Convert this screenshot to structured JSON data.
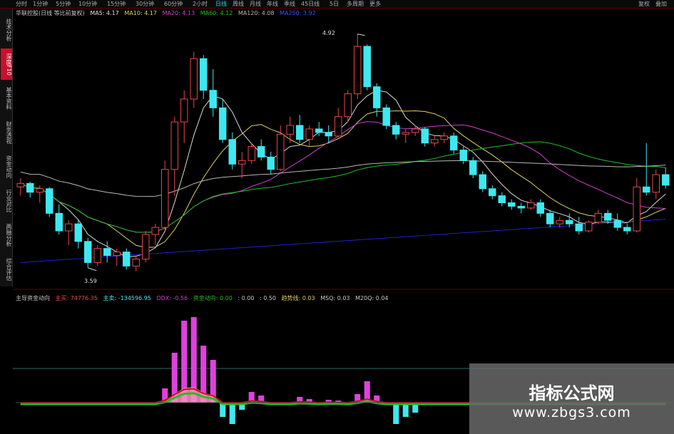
{
  "top_bar": {
    "tabs": [
      "分时",
      "1分钟",
      "5分钟",
      "10分钟",
      "15分钟",
      "30分钟",
      "60分钟",
      "2小时",
      "日线",
      "周线",
      "月线",
      "年线",
      "季线",
      "45日线",
      "5日",
      "多周期",
      "更多"
    ],
    "active": "日线",
    "right_items": [
      "复权",
      "叠加"
    ]
  },
  "left_tabs": [
    "技术分析",
    "深度F10",
    "基本资料",
    "财务透视",
    "资金动向",
    "行业对比",
    "两融分析",
    "综合评估"
  ],
  "main_info": {
    "stock": "华联控股(日线 等比前复权)",
    "ma5": "MA5: 4.17",
    "ma10": "MA10: 4.17",
    "ma20": "MA20: 4.13",
    "ma60": "MA60: 4.12",
    "ma120": "MA120: 4.08",
    "ma250": "MA250: 3.92"
  },
  "price_marks": {
    "high": "4.92",
    "low": "3.59"
  },
  "sub_info": {
    "name": "主导资金动向",
    "zhumai": "主买: 74776.35",
    "zhumai_arrow": "↑",
    "zhumai2": "主卖: -134596.95",
    "zhumai2_arrow": "↓",
    "ddx": "DDX: -0.56",
    "zjdx": "资金动向: 0.00",
    "v1": ": 0.00",
    "v2": ": 0.50",
    "qs": "趋势线: 0.03",
    "msq": "MSQ: 0.03",
    "m20q": "M20Q: 0.04"
  },
  "watermark": {
    "line1": "指标公式网",
    "line2": "www.zbgs3.com"
  },
  "colors": {
    "up": "#e8474a",
    "down": "#3ee8f0",
    "ma5": "#d8d8d8",
    "ma10": "#e0d060",
    "ma20": "#d040d0",
    "ma60": "#20c020",
    "ma120": "#b8b8b0",
    "ma250": "#2020c8"
  },
  "chart_data": {
    "type": "candlestick",
    "candles_note": "daily OHLC estimated from price axis",
    "candles": [
      [
        4.05,
        4.1,
        4.0,
        4.07
      ],
      [
        4.07,
        4.08,
        3.99,
        4.02
      ],
      [
        4.02,
        4.06,
        3.96,
        4.04
      ],
      [
        4.04,
        4.05,
        3.88,
        3.9
      ],
      [
        3.9,
        3.95,
        3.78,
        3.8
      ],
      [
        3.8,
        3.86,
        3.72,
        3.84
      ],
      [
        3.84,
        3.86,
        3.7,
        3.74
      ],
      [
        3.74,
        3.76,
        3.59,
        3.62
      ],
      [
        3.62,
        3.72,
        3.6,
        3.7
      ],
      [
        3.7,
        3.74,
        3.62,
        3.66
      ],
      [
        3.66,
        3.7,
        3.6,
        3.68
      ],
      [
        3.68,
        3.7,
        3.58,
        3.6
      ],
      [
        3.6,
        3.66,
        3.57,
        3.64
      ],
      [
        3.64,
        3.8,
        3.62,
        3.78
      ],
      [
        3.78,
        3.84,
        3.72,
        3.82
      ],
      [
        3.82,
        4.2,
        3.8,
        4.15
      ],
      [
        4.15,
        4.45,
        4.0,
        4.42
      ],
      [
        4.42,
        4.6,
        4.3,
        4.55
      ],
      [
        4.55,
        4.82,
        4.5,
        4.78
      ],
      [
        4.78,
        4.8,
        4.55,
        4.6
      ],
      [
        4.6,
        4.72,
        4.45,
        4.5
      ],
      [
        4.5,
        4.55,
        4.3,
        4.32
      ],
      [
        4.32,
        4.36,
        4.15,
        4.18
      ],
      [
        4.18,
        4.25,
        4.1,
        4.2
      ],
      [
        4.2,
        4.3,
        4.18,
        4.28
      ],
      [
        4.28,
        4.32,
        4.2,
        4.22
      ],
      [
        4.22,
        4.25,
        4.12,
        4.15
      ],
      [
        4.15,
        4.4,
        4.14,
        4.35
      ],
      [
        4.35,
        4.45,
        4.3,
        4.4
      ],
      [
        4.4,
        4.46,
        4.3,
        4.32
      ],
      [
        4.32,
        4.4,
        4.28,
        4.38
      ],
      [
        4.38,
        4.42,
        4.34,
        4.36
      ],
      [
        4.36,
        4.4,
        4.3,
        4.34
      ],
      [
        4.34,
        4.5,
        4.33,
        4.45
      ],
      [
        4.45,
        4.6,
        4.42,
        4.58
      ],
      [
        4.58,
        4.92,
        4.55,
        4.85
      ],
      [
        4.85,
        4.86,
        4.6,
        4.62
      ],
      [
        4.62,
        4.64,
        4.45,
        4.5
      ],
      [
        4.5,
        4.52,
        4.38,
        4.4
      ],
      [
        4.4,
        4.42,
        4.32,
        4.35
      ],
      [
        4.35,
        4.38,
        4.3,
        4.36
      ],
      [
        4.36,
        4.4,
        4.34,
        4.38
      ],
      [
        4.38,
        4.39,
        4.28,
        4.3
      ],
      [
        4.3,
        4.34,
        4.28,
        4.32
      ],
      [
        4.32,
        4.36,
        4.3,
        4.34
      ],
      [
        4.34,
        4.36,
        4.24,
        4.26
      ],
      [
        4.26,
        4.28,
        4.18,
        4.2
      ],
      [
        4.2,
        4.22,
        4.1,
        4.12
      ],
      [
        4.12,
        4.14,
        4.02,
        4.04
      ],
      [
        4.04,
        4.06,
        3.98,
        4.0
      ],
      [
        4.0,
        4.02,
        3.94,
        3.96
      ],
      [
        3.96,
        3.98,
        3.92,
        3.94
      ],
      [
        3.94,
        3.96,
        3.9,
        3.93
      ],
      [
        3.93,
        3.98,
        3.92,
        3.96
      ],
      [
        3.96,
        3.98,
        3.88,
        3.9
      ],
      [
        3.9,
        3.92,
        3.82,
        3.84
      ],
      [
        3.84,
        3.88,
        3.82,
        3.86
      ],
      [
        3.86,
        3.9,
        3.82,
        3.84
      ],
      [
        3.84,
        3.88,
        3.78,
        3.8
      ],
      [
        3.8,
        3.86,
        3.79,
        3.85
      ],
      [
        3.85,
        3.92,
        3.84,
        3.9
      ],
      [
        3.9,
        3.92,
        3.84,
        3.86
      ],
      [
        3.86,
        3.9,
        3.8,
        3.82
      ],
      [
        3.82,
        3.84,
        3.78,
        3.8
      ],
      [
        3.8,
        4.1,
        3.79,
        4.05
      ],
      [
        4.05,
        4.3,
        4.0,
        4.02
      ],
      [
        4.02,
        4.15,
        3.98,
        4.12
      ],
      [
        4.12,
        4.16,
        4.04,
        4.06
      ]
    ],
    "price_range": [
      3.5,
      5.0
    ],
    "sub": {
      "up_bars": [
        0,
        0,
        0,
        0,
        0,
        0,
        0,
        0,
        0,
        0,
        0,
        0,
        0,
        0,
        0,
        20,
        70,
        115,
        120,
        80,
        60,
        0,
        0,
        0,
        15,
        10,
        0,
        0,
        0,
        8,
        5,
        0,
        4,
        3,
        0,
        12,
        30,
        10,
        0,
        0,
        0,
        0,
        0,
        0,
        0,
        0,
        0,
        0,
        0,
        0,
        0,
        0,
        0,
        0,
        0,
        0,
        0,
        0,
        0,
        0,
        0,
        0,
        0,
        0,
        0,
        0,
        0,
        0
      ],
      "down_bars": [
        0,
        0,
        0,
        0,
        0,
        0,
        0,
        0,
        0,
        0,
        0,
        0,
        0,
        0,
        0,
        0,
        0,
        0,
        0,
        0,
        0,
        20,
        30,
        10,
        0,
        0,
        0,
        0,
        0,
        0,
        0,
        0,
        0,
        0,
        0,
        0,
        0,
        0,
        0,
        30,
        20,
        14,
        0,
        0,
        0,
        0,
        0,
        0,
        0,
        0,
        0,
        0,
        0,
        0,
        0,
        0,
        0,
        0,
        0,
        0,
        0,
        0,
        0,
        0,
        0,
        0,
        0,
        0
      ]
    }
  }
}
